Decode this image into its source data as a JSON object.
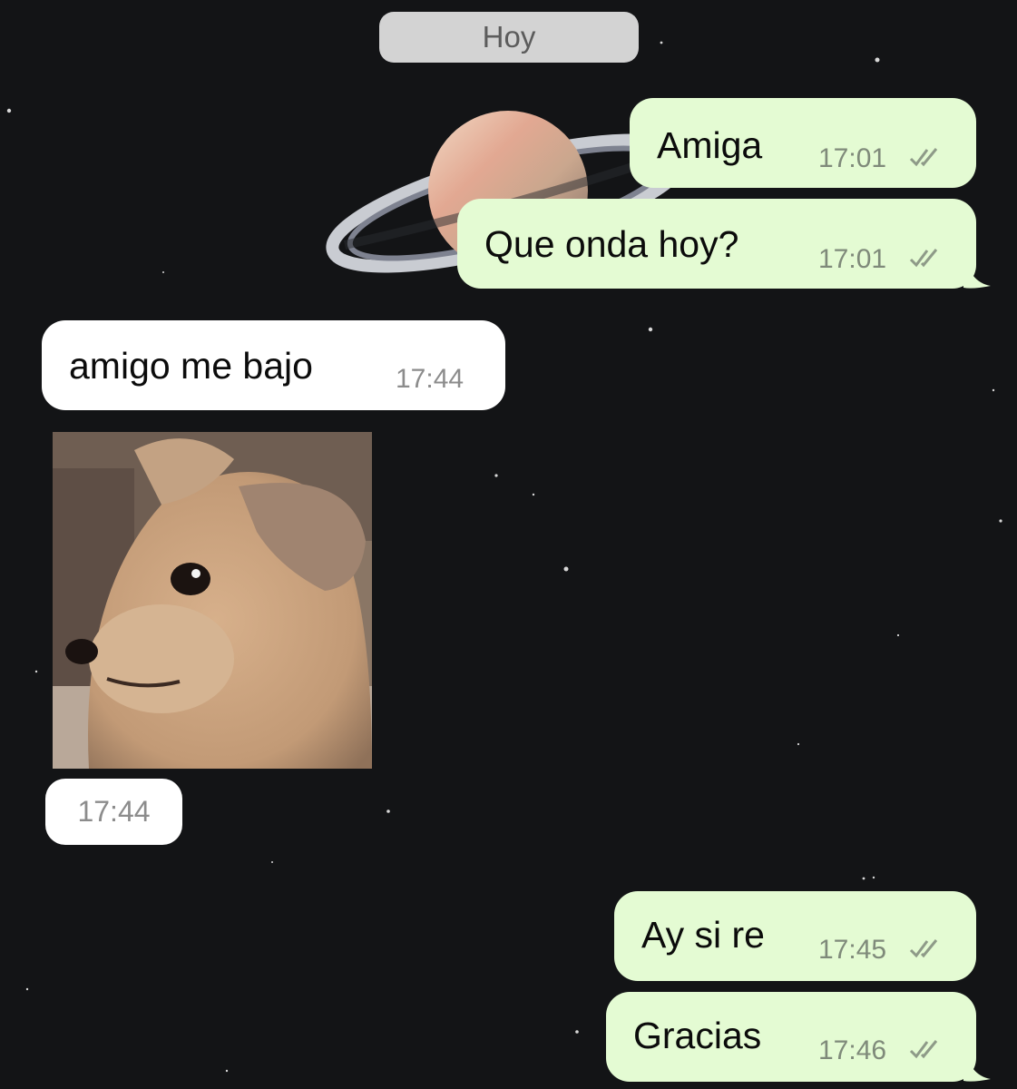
{
  "chat": {
    "date_divider": "Hoy",
    "messages": [
      {
        "text": "Amiga",
        "time": "17:01"
      },
      {
        "text": "Que onda hoy?",
        "time": "17:01"
      },
      {
        "text": "amigo me bajo",
        "time": "17:44"
      },
      {
        "time": "17:44"
      },
      {
        "text": "Ay si re",
        "time": "17:45"
      },
      {
        "text": "Gracias",
        "time": "17:46"
      }
    ]
  },
  "icons": {
    "read_receipt": "double-check-icon",
    "wallpaper": "saturn-starfield",
    "image_subject": "puppy-photo"
  },
  "colors": {
    "outgoing_bubble": "#e4fbd3",
    "incoming_bubble": "#ffffff",
    "background": "#131416",
    "date_pill": "#d3d3d3"
  }
}
